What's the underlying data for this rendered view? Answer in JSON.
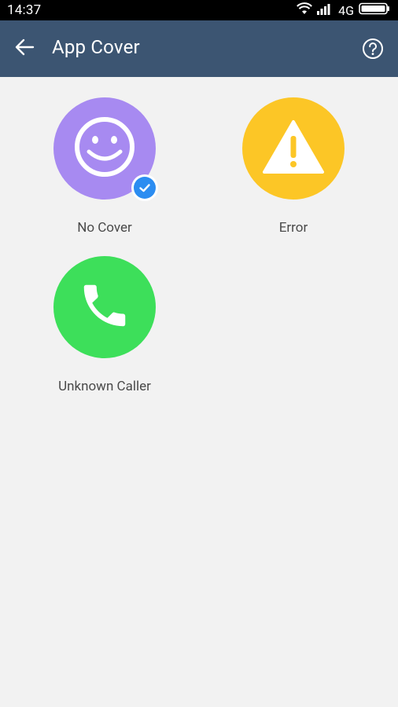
{
  "status_bar": {
    "time": "14:37",
    "network": "4G",
    "icons": [
      "wifi-icon",
      "signal-icon",
      "battery-icon"
    ]
  },
  "app_bar": {
    "title": "App Cover",
    "back_icon": "arrow-left-icon",
    "help_icon": "help-circle-icon",
    "background": "#3c5572"
  },
  "covers": [
    {
      "label": "No Cover",
      "icon": "smiley-icon",
      "color": "#a78af1",
      "selected": true
    },
    {
      "label": "Error",
      "icon": "warning-icon",
      "color": "#fcc626",
      "selected": false
    },
    {
      "label": "Unknown Caller",
      "icon": "phone-icon",
      "color": "#3ddf5a",
      "selected": false
    }
  ],
  "colors": {
    "selected_badge": "#2c8df1",
    "background": "#f2f2f2"
  }
}
